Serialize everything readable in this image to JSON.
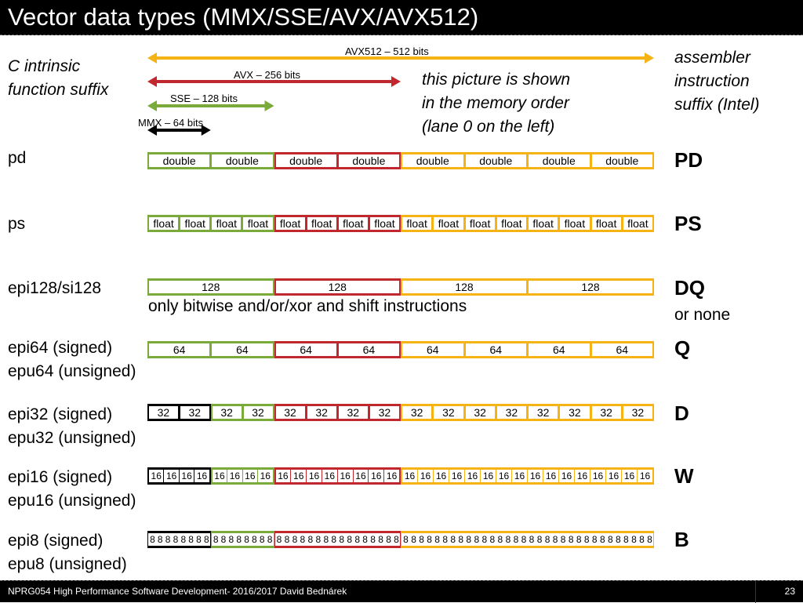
{
  "slide": {
    "title": "Vector data types (MMX/SSE/AVX/AVX512)",
    "left_heading": [
      "C intrinsic",
      "function suffix"
    ],
    "right_heading": [
      "assembler",
      "instruction",
      "suffix (Intel)"
    ],
    "note": [
      "this picture is shown",
      "in the memory order",
      "(lane 0 on the left)"
    ],
    "bitwise_note": "only bitwise and/or/xor and shift instructions",
    "colors": {
      "mmx": "#000000",
      "sse": "#7aab3a",
      "avx": "#c0282e",
      "avx512": "#f5b414"
    },
    "arrows": [
      {
        "id": "avx512",
        "label": "AVX512 – 512 bits",
        "bits": 512,
        "color": "#f5b414"
      },
      {
        "id": "avx",
        "label": "AVX – 256 bits",
        "bits": 256,
        "color": "#c0282e"
      },
      {
        "id": "sse",
        "label": "SSE – 128 bits",
        "bits": 128,
        "color": "#7aab3a"
      },
      {
        "id": "mmx",
        "label": "MMX – 64 bits",
        "bits": 64,
        "color": "#000000"
      }
    ],
    "rows": [
      {
        "id": "pd",
        "left": [
          "pd"
        ],
        "right": "PD",
        "right_sub": "",
        "cell": "double",
        "lanes": 8,
        "mmx": false
      },
      {
        "id": "ps",
        "left": [
          "ps"
        ],
        "right": "PS",
        "right_sub": "",
        "cell": "float",
        "lanes": 16,
        "mmx": false
      },
      {
        "id": "epi128",
        "left": [
          "epi128/si128"
        ],
        "right": "DQ",
        "right_sub": "or none",
        "cell": "128",
        "lanes": 4,
        "mmx": false
      },
      {
        "id": "epi64",
        "left": [
          "epi64 (signed)",
          "epu64 (unsigned)"
        ],
        "right": "Q",
        "right_sub": "",
        "cell": "64",
        "lanes": 8,
        "mmx": false
      },
      {
        "id": "epi32",
        "left": [
          "epi32 (signed)",
          "epu32 (unsigned)"
        ],
        "right": "D",
        "right_sub": "",
        "cell": "32",
        "lanes": 16,
        "mmx": true
      },
      {
        "id": "epi16",
        "left": [
          "epi16 (signed)",
          "epu16 (unsigned)"
        ],
        "right": "W",
        "right_sub": "",
        "cell": "16",
        "lanes": 32,
        "mmx": true
      },
      {
        "id": "epi8",
        "left": [
          "epi8 (signed)",
          "epu8 (unsigned)"
        ],
        "right": "B",
        "right_sub": "",
        "cell": "8",
        "lanes": 64,
        "mmx": true
      }
    ],
    "footer": {
      "text": "NPRG054 High Performance Software Development- 2016/2017 David Bednárek",
      "page": "23"
    }
  }
}
